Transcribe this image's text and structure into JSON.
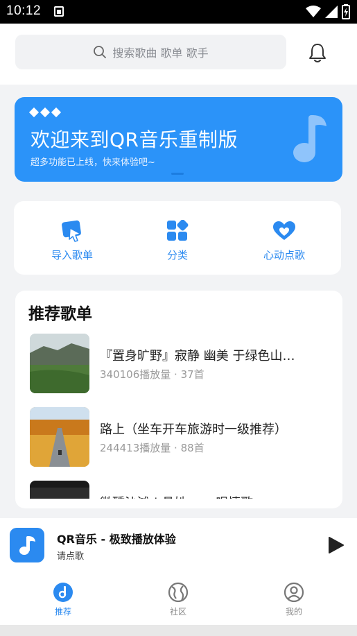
{
  "status_bar": {
    "time": "10:12"
  },
  "header": {
    "search_placeholder": "搜索歌曲 歌单 歌手"
  },
  "banner": {
    "title": "欢迎来到QR音乐重制版",
    "subtitle": "超多功能已上线，快来体验吧~"
  },
  "quick_actions": [
    {
      "label": "导入歌单",
      "icon": "import-playlist-icon"
    },
    {
      "label": "分类",
      "icon": "category-grid-icon"
    },
    {
      "label": "心动点歌",
      "icon": "heart-icon"
    }
  ],
  "recommend": {
    "title": "推荐歌单",
    "playlists": [
      {
        "name": "『置身旷野』寂静 幽美 于绿色山…",
        "meta": "340106播放量 · 37首"
      },
      {
        "name": "路上（坐车开车旅游时一级推荐）",
        "meta": "244413播放量 · 88首"
      },
      {
        "name": "微醺沙滩 | 悬她…… 唱情歌",
        "meta": ""
      }
    ]
  },
  "player": {
    "title": "QR音乐 - 极致播放体验",
    "subtitle": "请点歌"
  },
  "tabs": [
    {
      "label": "推荐",
      "active": true
    },
    {
      "label": "社区",
      "active": false
    },
    {
      "label": "我的",
      "active": false
    }
  ],
  "colors": {
    "accent": "#2b8af0",
    "banner": "#2b93f9",
    "background": "#f2f3f5"
  }
}
